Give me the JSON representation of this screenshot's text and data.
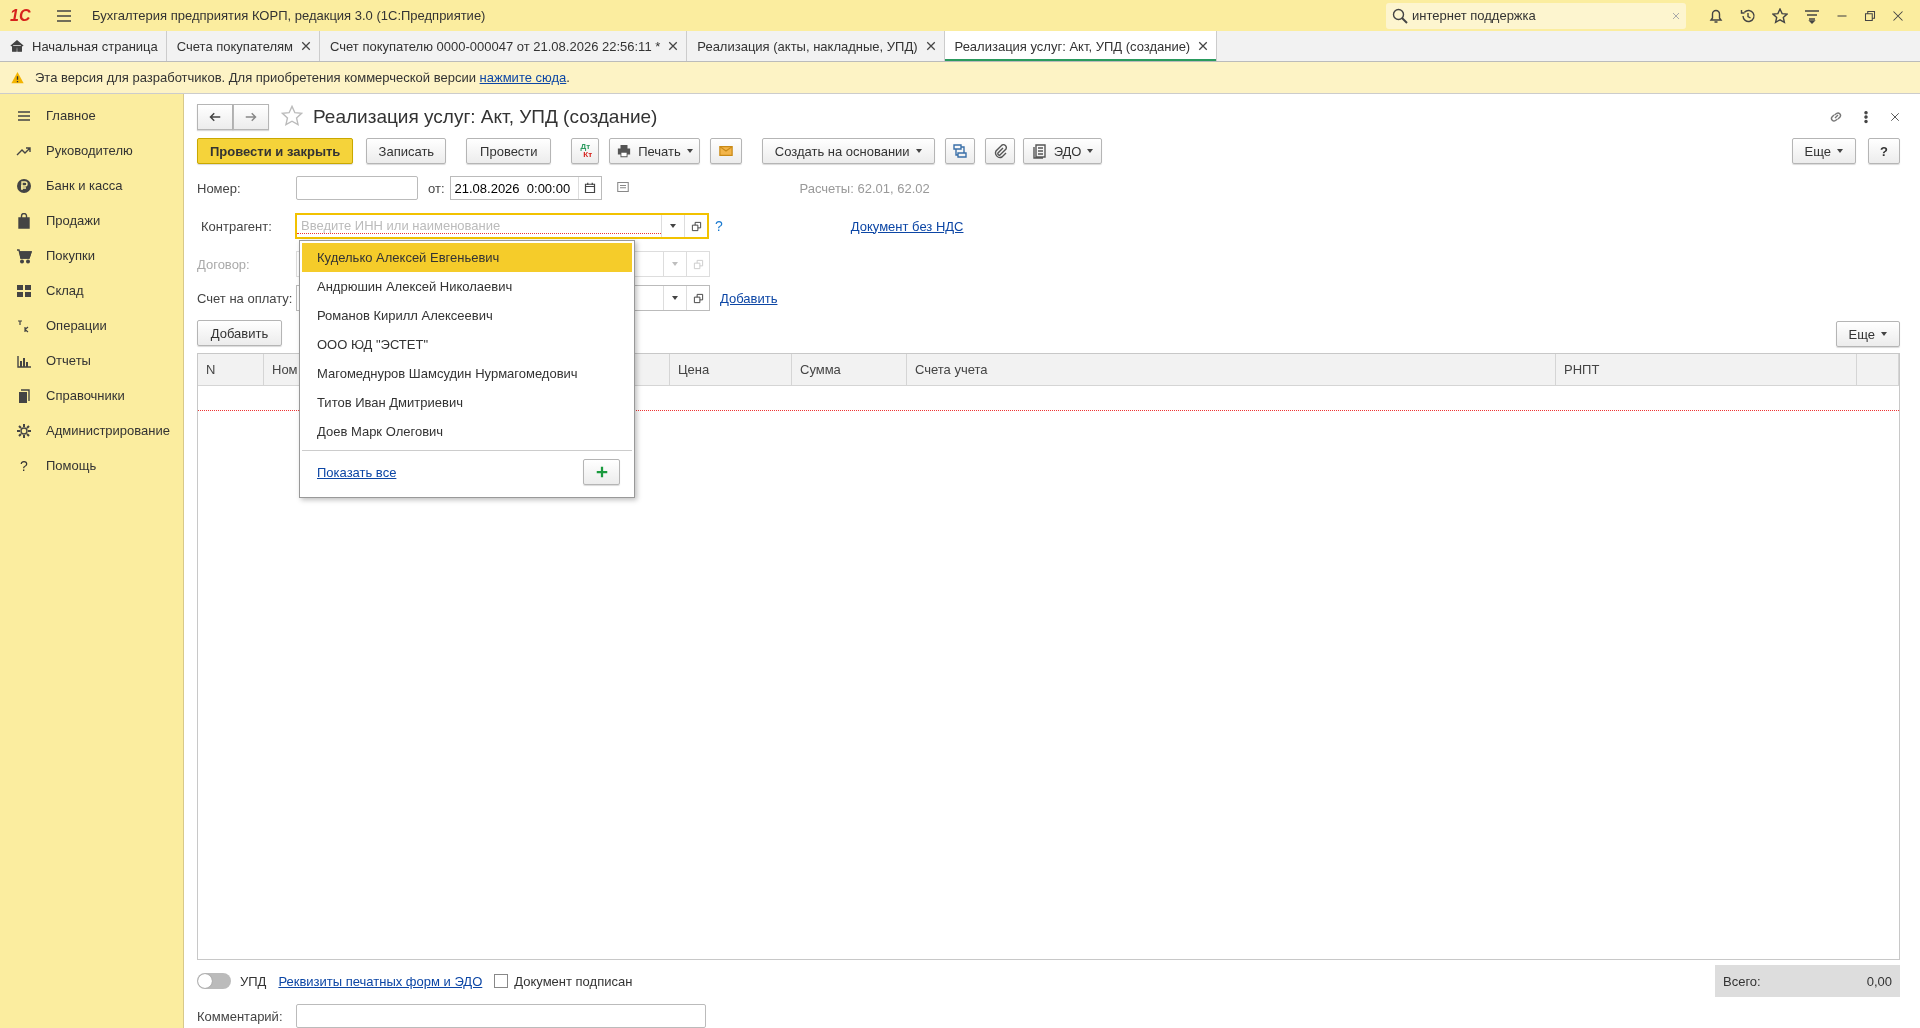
{
  "app_bar": {
    "logo": "1С",
    "title": "Бухгалтерия предприятия КОРП, редакция 3.0  (1С:Предприятие)",
    "search": {
      "value": "интернет поддержка"
    }
  },
  "tabs": [
    {
      "label": "Начальная страница",
      "kind": "home",
      "selected": false
    },
    {
      "label": "Счета покупателям",
      "kind": "doc",
      "selected": false
    },
    {
      "label": "Счет покупателю 0000-000047 от 21.08.2026 22:56:11 *",
      "kind": "doc",
      "selected": false
    },
    {
      "label": "Реализация (акты, накладные, УПД)",
      "kind": "doc",
      "selected": false
    },
    {
      "label": "Реализация услуг: Акт, УПД (создание)",
      "kind": "doc",
      "selected": true
    }
  ],
  "notice": {
    "text": "Эта версия для разработчиков. Для приобретения коммерческой версии ",
    "link": "нажмите сюда",
    "tail": "."
  },
  "sidebar": {
    "items": [
      {
        "label": "Главное"
      },
      {
        "label": "Руководителю"
      },
      {
        "label": "Банк и касса"
      },
      {
        "label": "Продажи"
      },
      {
        "label": "Покупки"
      },
      {
        "label": "Склад"
      },
      {
        "label": "Операции"
      },
      {
        "label": "Отчеты"
      },
      {
        "label": "Справочники"
      },
      {
        "label": "Администрирование"
      },
      {
        "label": "Помощь",
        "mark": "?"
      }
    ]
  },
  "form": {
    "title": "Реализация услуг: Акт, УПД (создание)",
    "toolbar": {
      "post_close": "Провести и закрыть",
      "save": "Записать",
      "post": "Провести",
      "dtkt": [
        "Дт",
        "Кт"
      ],
      "print": "Печать",
      "create_based": "Создать на основании",
      "edo": "ЭДО",
      "more": "Еще",
      "help": "?"
    },
    "number": {
      "label": "Номер:",
      "date_label": "от:",
      "date": "21.08.2026  0:00:00",
      "accounts": "Расчеты: 62.01, 62.02"
    },
    "counterparty": {
      "label": "Контрагент:",
      "placeholder": "Введите ИНН или наименование",
      "help": "?",
      "link": "Документ без НДС"
    },
    "contract": {
      "label": "Договор:",
      "disabled": true
    },
    "invoice": {
      "label": "Счет на оплату:",
      "link": "Добавить"
    },
    "add_button": "Добавить",
    "table_more": "Еще",
    "table": {
      "columns": [
        "N",
        "Ном",
        "",
        "Цена",
        "Сумма",
        "Счета учета",
        "РНПТ",
        ""
      ]
    },
    "dropdown": {
      "items": [
        {
          "label": "Куделько Алексей Евгеньевич",
          "selected": true
        },
        {
          "label": "Андрюшин Алексей Николаевич",
          "selected": false
        },
        {
          "label": "Романов Кирилл Алексеевич",
          "selected": false
        },
        {
          "label": "ООО ЮД \"ЭСТЕТ\"",
          "selected": false
        },
        {
          "label": "Магомеднуров Шамсудин Нурмагомедович",
          "selected": false
        },
        {
          "label": "Титов Иван Дмитриевич",
          "selected": false
        },
        {
          "label": "Доев Марк Олегович",
          "selected": false
        }
      ],
      "show_all": "Показать все"
    },
    "footer": {
      "upd": {
        "label": "УПД",
        "on": false
      },
      "requisites_link": "Реквизиты печатных форм и ЭДО",
      "signed": {
        "label": "Документ подписан",
        "checked": false
      },
      "total_label": "Всего:",
      "total": "0,00",
      "comment_label": "Комментарий:"
    }
  }
}
